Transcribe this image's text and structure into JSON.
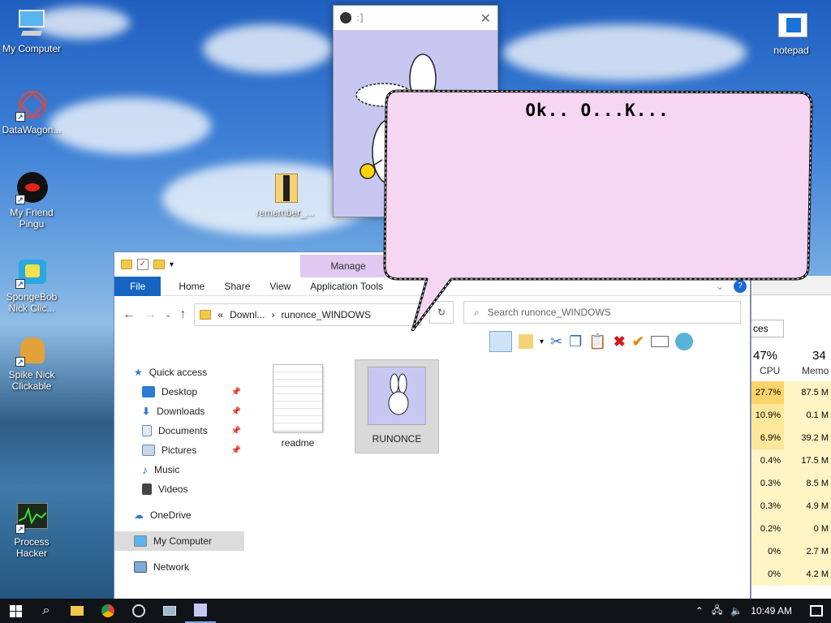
{
  "desktop": {
    "icons": [
      {
        "label": "My Computer"
      },
      {
        "label": "DataWagon..."
      },
      {
        "label": "My Friend Pingu"
      },
      {
        "label": "SpongeBob Nick Clic..."
      },
      {
        "label": "Spike Nick Clickable"
      },
      {
        "label": "Process Hacker"
      },
      {
        "label": "remember_..."
      },
      {
        "label": "notepad"
      }
    ]
  },
  "bunny_window": {
    "title": ":]"
  },
  "bubble": {
    "text": "Ok.. O...K..."
  },
  "explorer": {
    "contextual_tab": "Manage",
    "ribbon_tabs": [
      "File",
      "Home",
      "Share",
      "View",
      "Application Tools"
    ],
    "address": {
      "prefix": "«",
      "crumb1": "Downl...",
      "separator": "›",
      "crumb2": "runonce_WINDOWS"
    },
    "search_placeholder": "Search runonce_WINDOWS",
    "nav": {
      "quick_access": "Quick access",
      "items": [
        "Desktop",
        "Downloads",
        "Documents",
        "Pictures",
        "Music",
        "Videos"
      ],
      "onedrive": "OneDrive",
      "my_computer": "My Computer",
      "network": "Network"
    },
    "files": [
      {
        "name": "readme"
      },
      {
        "name": "RUNONCE"
      }
    ]
  },
  "taskmgr": {
    "tab_partial": "ces",
    "cpu_pct": "47%",
    "cpu_label": "CPU",
    "mem_pct": "34",
    "mem_label": "Memo",
    "rows": [
      {
        "cpu": "27.7%",
        "mem": "87.5 M"
      },
      {
        "cpu": "10.9%",
        "mem": "0.1 M"
      },
      {
        "cpu": "6.9%",
        "mem": "39.2 M"
      },
      {
        "cpu": "0.4%",
        "mem": "17.5 M"
      },
      {
        "cpu": "0.3%",
        "mem": "8.5 M"
      },
      {
        "cpu": "0.3%",
        "mem": "4.9 M"
      },
      {
        "cpu": "0.2%",
        "mem": "0 M"
      },
      {
        "cpu": "0%",
        "mem": "2.7 M"
      },
      {
        "cpu": "0%",
        "mem": "4.2 M"
      }
    ]
  },
  "taskbar": {
    "time": "10:49 AM"
  },
  "colors": {
    "taskbar": "#101318",
    "file_tab": "#1565c0",
    "manage_tab": "#e0c8f0",
    "bubble_fill": "#f6d6f3",
    "bunny_bg": "#c7c7f2",
    "cpu_high": "#ffd36b"
  }
}
